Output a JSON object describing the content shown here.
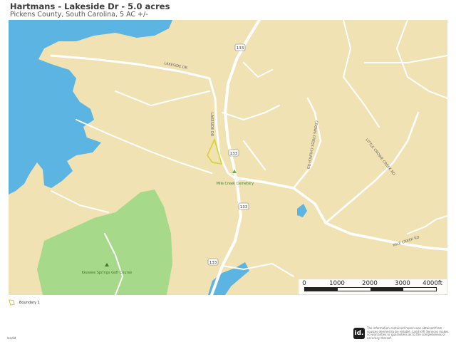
{
  "header": {
    "title": "Hartmans - Lakeside Dr - 5.0 acres",
    "subtitle": "Pickens County, South Carolina, 5 AC +/-"
  },
  "map": {
    "colors": {
      "land": "#f1e2b3",
      "water": "#5bb4e2",
      "park": "#a6d98a",
      "road": "#ffffff",
      "boundary": "#d9d22a",
      "route_shield": "#ffffff"
    },
    "road_labels": {
      "lakeside_dr_west": "LAKESIDE DR",
      "lakeside_dr_north": "LAKESIDE DR",
      "crowe_creek_church": "CROWE CREEK CHURCH RD",
      "little_crowe_creek": "LITTLE CROWE CREEK RD",
      "mile_creek_rd": "MILE CREEK RD"
    },
    "route_shields": [
      "133",
      "133",
      "133",
      "133"
    ],
    "poi_labels": {
      "cemetery": "Mile Creek Cemetery",
      "golf": "Keowee Springs Golf Course"
    }
  },
  "scale_bar": {
    "ticks": [
      "0",
      "1000",
      "2000",
      "3000",
      "4000ft"
    ]
  },
  "legend": {
    "label": "Boundary 1"
  },
  "footer": {
    "attribution": "landid",
    "logo_text": "id.",
    "disclaimer": "The information contained herein was obtained from sources deemed to be reliable. Land id® Services makes no warranties or guarantees as to the completeness or accuracy thereof."
  }
}
